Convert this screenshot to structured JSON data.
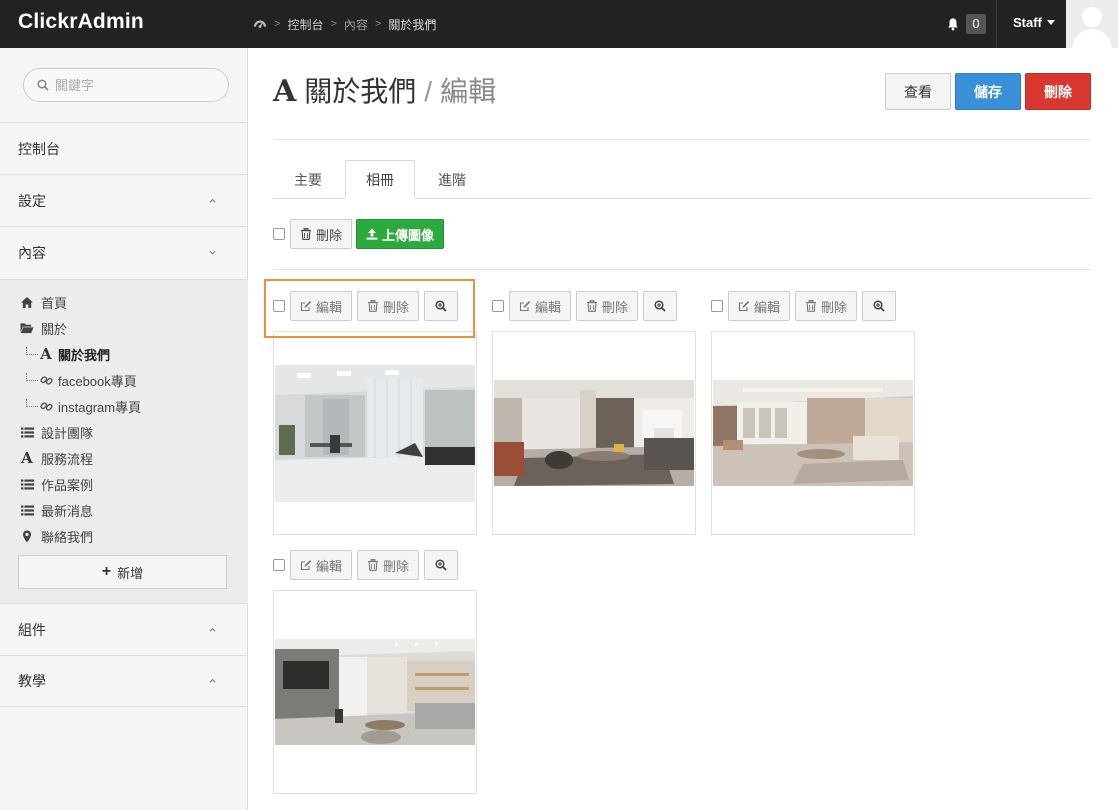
{
  "brand": "ClickrAdmin",
  "breadcrumb": {
    "items": [
      "控制台",
      "內容",
      "關於我們"
    ]
  },
  "notifications": {
    "count": "0"
  },
  "user": {
    "name": "Staff"
  },
  "sidebar": {
    "search_placeholder": "關鍵字",
    "sections": {
      "dashboard": "控制台",
      "settings": "設定",
      "content": "內容",
      "components": "組件",
      "tutorial": "教學"
    },
    "items": {
      "home": "首頁",
      "about": "關於",
      "about_us": "關於我們",
      "facebook": "facebook專頁",
      "instagram": "instagram專頁",
      "design_team": "設計團隊",
      "service_flow": "服務流程",
      "portfolio": "作品案例",
      "news": "最新消息",
      "contact": "聯絡我們"
    },
    "add_label": "新增"
  },
  "page": {
    "title": "關於我們",
    "subtitle": "編輯"
  },
  "header_buttons": {
    "view": "查看",
    "save": "儲存",
    "delete": "刪除"
  },
  "tabs": [
    "主要",
    "相冊",
    "進階"
  ],
  "toolbar": {
    "delete": "刪除",
    "upload": "上傳圖像"
  },
  "gallery": {
    "edit_label": "編輯",
    "delete_label": "刪除",
    "items": [
      "interior-office",
      "interior-living-1",
      "interior-living-2",
      "interior-living-3"
    ]
  },
  "colors": {
    "primary": "#3a8fd9",
    "danger": "#d9372f",
    "success": "#2daa3e",
    "highlight": "#e8923a",
    "topbar": "#222222"
  }
}
